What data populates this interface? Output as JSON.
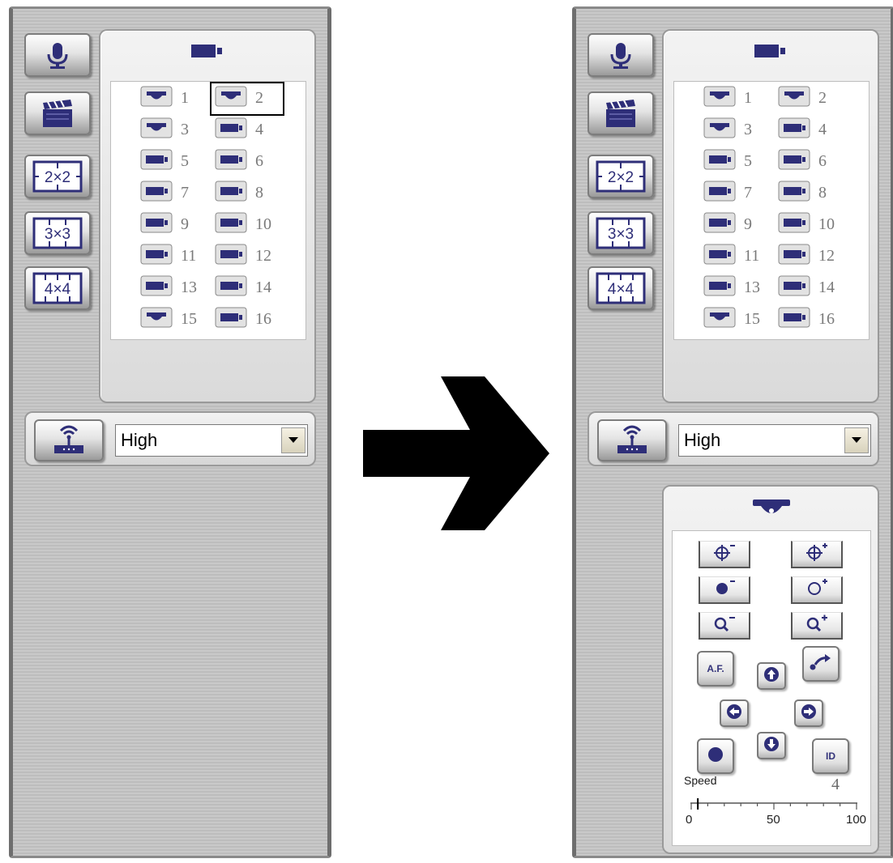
{
  "colors": {
    "icon_navy": "#2e2e78",
    "panel_gray": "#c4c4c4",
    "highlight_border": "#000000",
    "arrow": "#000000"
  },
  "cameras": {
    "header_icon": "video-camera-icon",
    "items": [
      {
        "num": "1",
        "type": "dome"
      },
      {
        "num": "2",
        "type": "dome"
      },
      {
        "num": "3",
        "type": "dome"
      },
      {
        "num": "4",
        "type": "box"
      },
      {
        "num": "5",
        "type": "box"
      },
      {
        "num": "6",
        "type": "box"
      },
      {
        "num": "7",
        "type": "box"
      },
      {
        "num": "8",
        "type": "box"
      },
      {
        "num": "9",
        "type": "box"
      },
      {
        "num": "10",
        "type": "box"
      },
      {
        "num": "11",
        "type": "box"
      },
      {
        "num": "12",
        "type": "box"
      },
      {
        "num": "13",
        "type": "box"
      },
      {
        "num": "14",
        "type": "box"
      },
      {
        "num": "15",
        "type": "dome"
      },
      {
        "num": "16",
        "type": "box"
      }
    ],
    "selected_left": "2"
  },
  "side_buttons": {
    "audio": "microphone-icon",
    "record": "clapperboard-icon",
    "layout_2x2": "2×2",
    "layout_3x3": "3×3",
    "layout_4x4": "4×4"
  },
  "quality": {
    "icon": "network-router-icon",
    "selected": "High"
  },
  "ptz": {
    "header_icon": "dome-camera-icon",
    "buttons": {
      "focus_minus": "focus-minus-icon",
      "focus_plus": "focus-plus-icon",
      "iris_minus": "iris-close-icon",
      "iris_plus": "iris-open-icon",
      "zoom_minus": "zoom-out-icon",
      "zoom_plus": "zoom-in-icon",
      "auto_focus": "A.F.",
      "up": "arrow-up-icon",
      "preset_return": "return-arrow-icon",
      "left": "arrow-left-icon",
      "right": "arrow-right-icon",
      "record_point": "record-dot-icon",
      "down": "arrow-down-icon",
      "id": "ID"
    },
    "speed_label": "Speed",
    "speed_value": "4",
    "speed_min": "0",
    "speed_mid": "50",
    "speed_max": "100",
    "speed_level": 4
  }
}
